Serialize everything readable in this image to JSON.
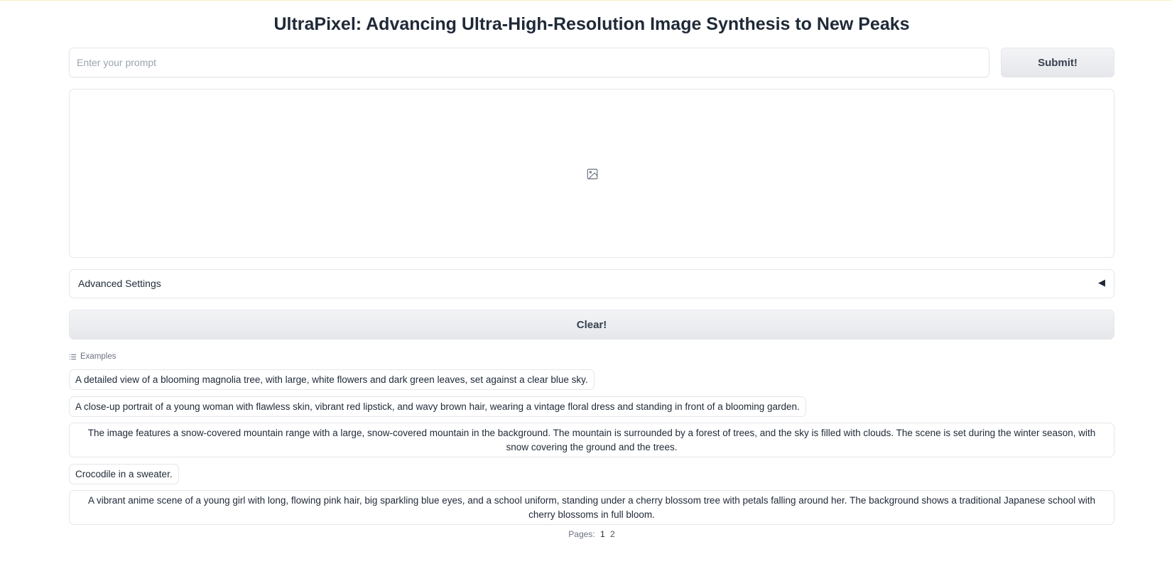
{
  "header": {
    "title": "UltraPixel: Advancing Ultra-High-Resolution Image Synthesis to New Peaks"
  },
  "prompt": {
    "placeholder": "Enter your prompt",
    "value": "",
    "submit_label": "Submit!"
  },
  "output": {
    "icon": "image-icon"
  },
  "advanced": {
    "label": "Advanced Settings",
    "caret": "◀"
  },
  "clear_label": "Clear!",
  "examples": {
    "header": "Examples",
    "items": [
      "A detailed view of a blooming magnolia tree, with large, white flowers and dark green leaves, set against a clear blue sky.",
      "A close-up portrait of a young woman with flawless skin, vibrant red lipstick, and wavy brown hair, wearing a vintage floral dress and standing in front of a blooming garden.",
      "The image features a snow-covered mountain range with a large, snow-covered mountain in the background. The mountain is surrounded by a forest of trees, and the sky is filled with clouds. The scene is set during the winter season, with snow covering the ground and the trees.",
      "Crocodile in a sweater.",
      "A vibrant anime scene of a young girl with long, flowing pink hair, big sparkling blue eyes, and a school uniform, standing under a cherry blossom tree with petals falling around her. The background shows a traditional Japanese school with cherry blossoms in full bloom."
    ]
  },
  "pagination": {
    "label": "Pages:",
    "pages": [
      "1",
      "2"
    ],
    "current": "1"
  },
  "colors": {
    "border": "#e5e7eb",
    "button_bg": "#e5e7eb",
    "text": "#1f2937",
    "muted": "#6b7280"
  }
}
